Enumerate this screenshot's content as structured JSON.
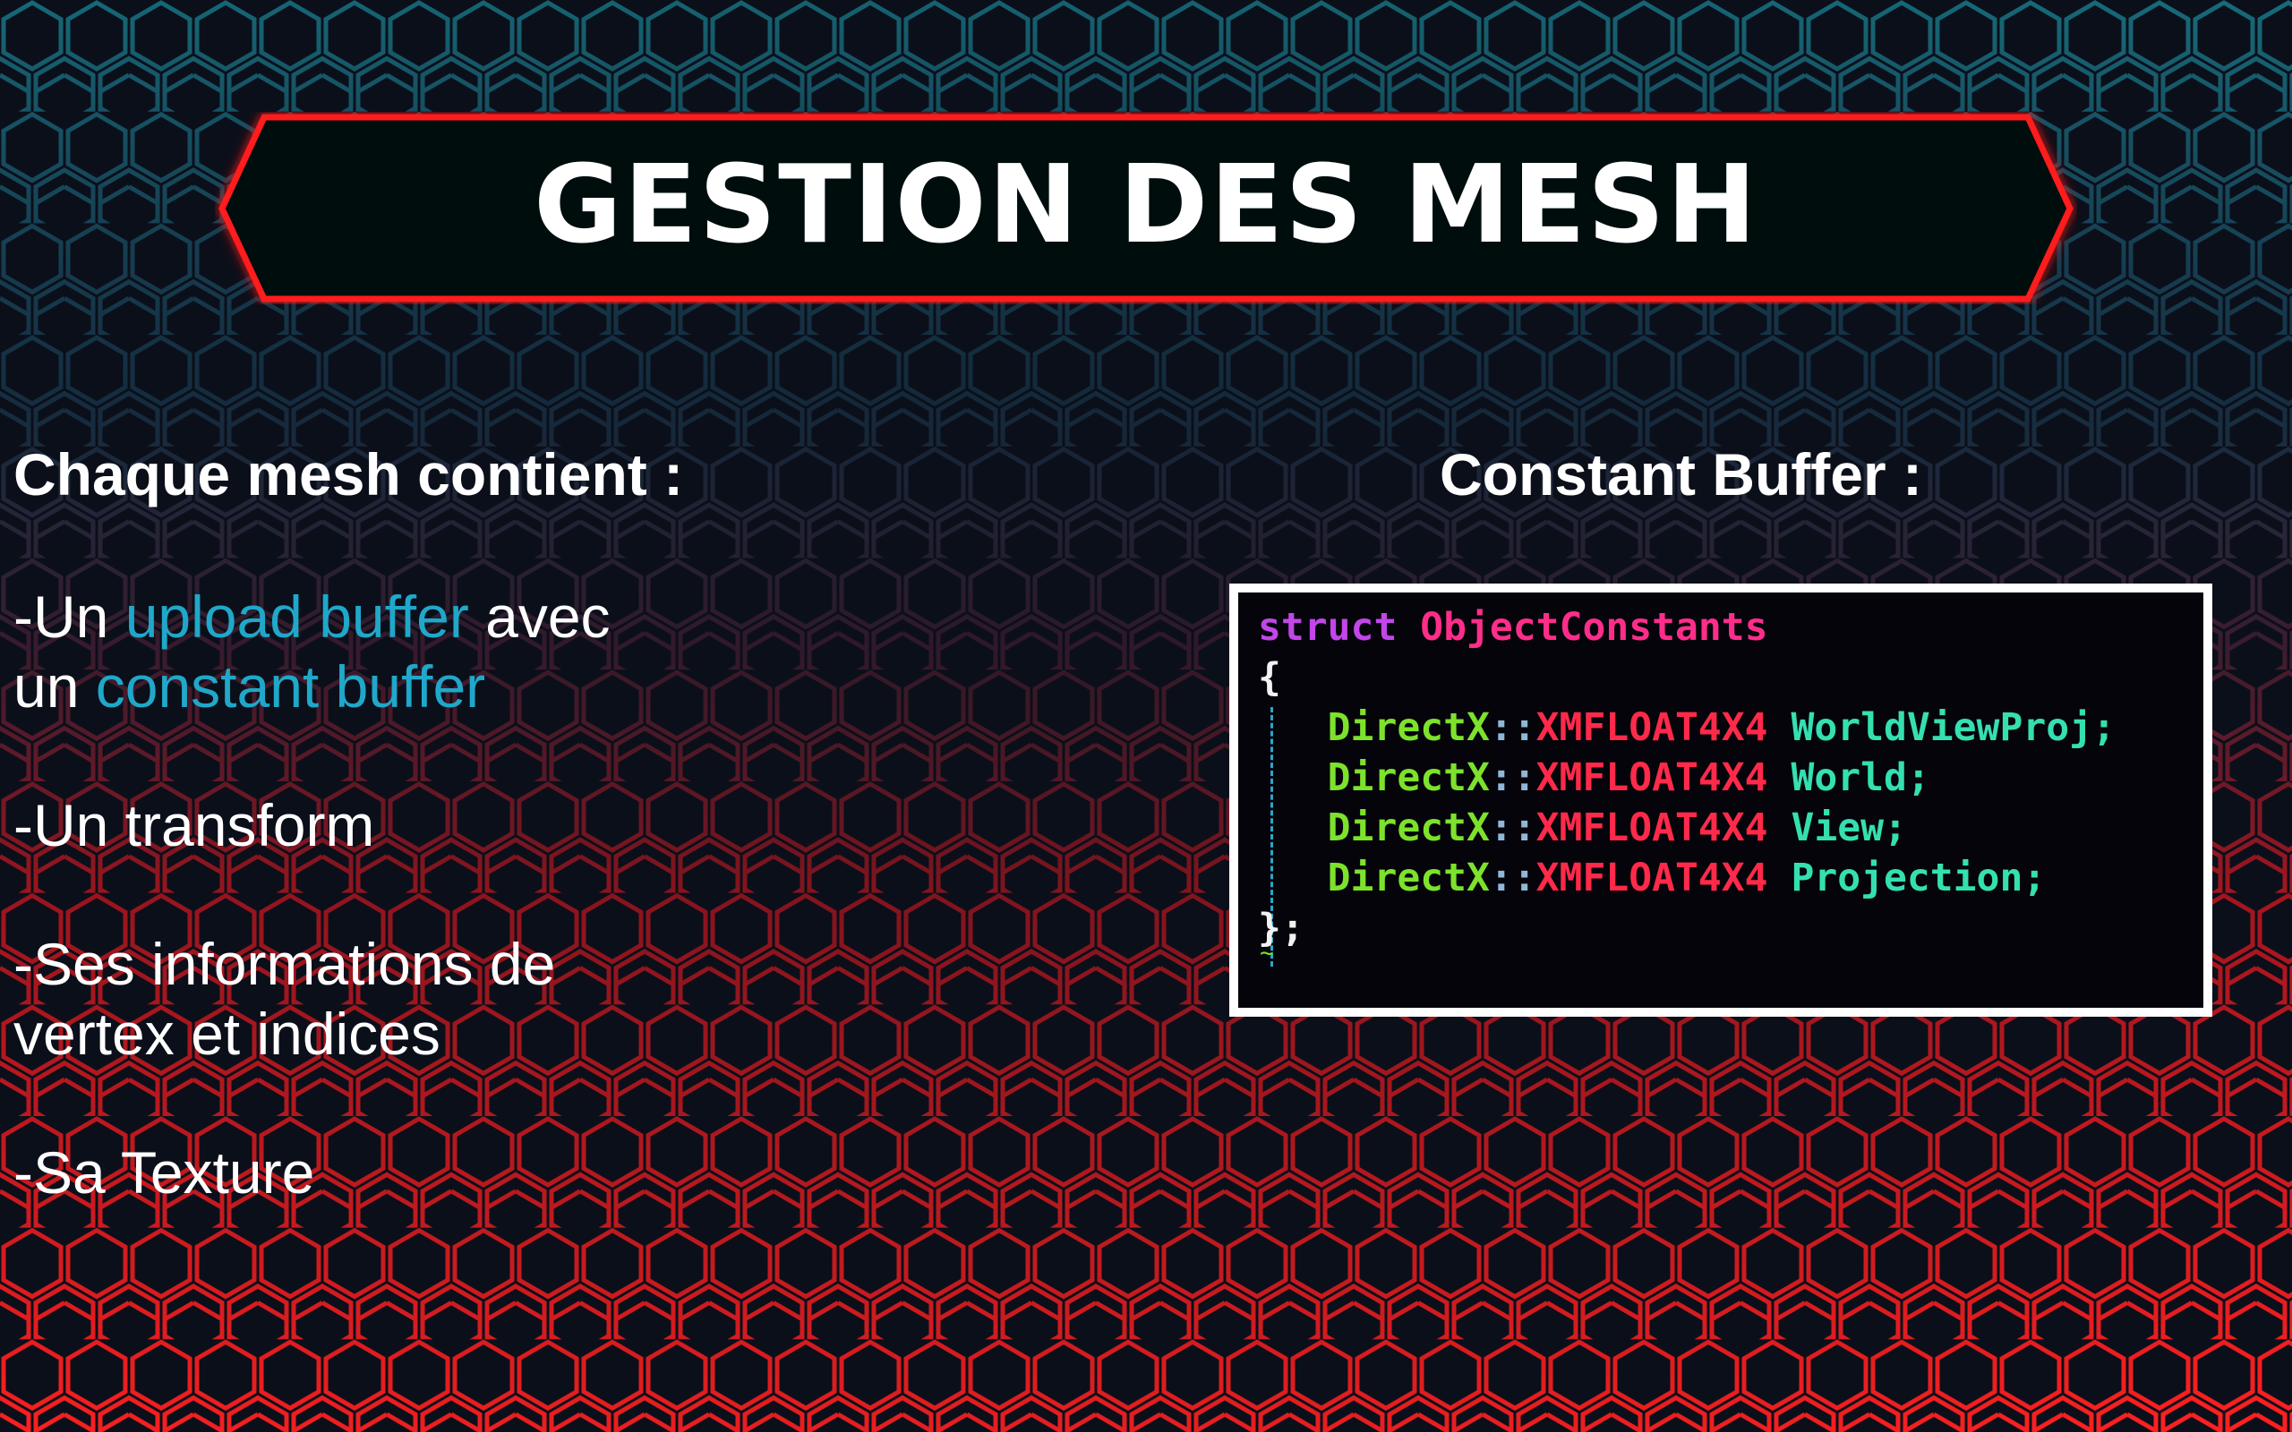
{
  "slide": {
    "title": "GESTION DES MESH",
    "left_heading": "Chaque mesh contient :",
    "right_heading": "Constant Buffer :",
    "bullets": {
      "b1_prefix": "-Un ",
      "b1_highlight1": "upload buffer",
      "b1_middle": " avec",
      "b1_line2_prefix": "un ",
      "b1_highlight2": "constant buffer",
      "b2": "-Un transform",
      "b3_line1": "-Ses informations de",
      "b3_line2": "vertex et indices",
      "b4": "-Sa Texture"
    },
    "code": {
      "keyword": "struct",
      "struct_name": "ObjectConstants",
      "open_brace": "{",
      "close_brace": "};",
      "namespace": "DirectX",
      "scope_op": "::",
      "type": "XMFLOAT4X4",
      "fields": [
        "WorldViewProj;",
        "World;",
        "View;",
        "Projection;"
      ]
    }
  },
  "colors": {
    "highlight": "#1fa8c9",
    "banner_border": "#ff1a1a",
    "hex_red": "#e01818",
    "hex_teal": "#1a8a9a",
    "code_keyword": "#c246e8",
    "code_type": "#ff2d8a",
    "code_namespace": "#7ce22b",
    "code_identifier": "#34e0b0"
  }
}
